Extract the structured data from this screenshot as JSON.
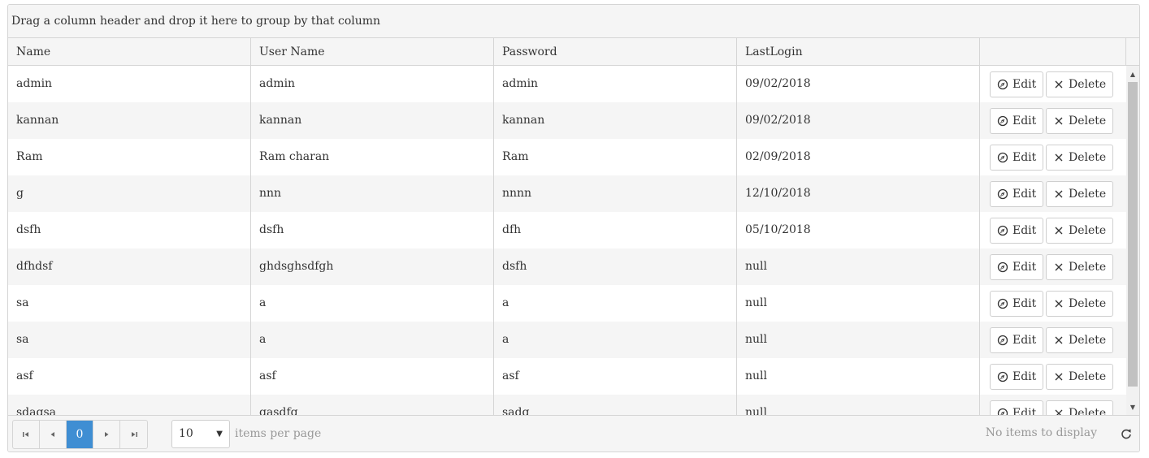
{
  "group_panel": {
    "hint": "Drag a column header and drop it here to group by that column"
  },
  "columns": [
    {
      "label": "Name"
    },
    {
      "label": "User Name"
    },
    {
      "label": "Password"
    },
    {
      "label": "LastLogin"
    },
    {
      "label": ""
    }
  ],
  "rows": [
    {
      "name": "admin",
      "user_name": "admin",
      "password": "admin",
      "last_login": "09/02/2018"
    },
    {
      "name": "kannan",
      "user_name": "kannan",
      "password": "kannan",
      "last_login": "09/02/2018"
    },
    {
      "name": "Ram",
      "user_name": "Ram charan",
      "password": "Ram",
      "last_login": "02/09/2018"
    },
    {
      "name": "g",
      "user_name": "nnn",
      "password": "nnnn",
      "last_login": "12/10/2018"
    },
    {
      "name": "dsfh",
      "user_name": "dsfh",
      "password": "dfh",
      "last_login": "05/10/2018"
    },
    {
      "name": "dfhdsf",
      "user_name": "ghdsghsdfgh",
      "password": "dsfh",
      "last_login": "null"
    },
    {
      "name": "sa",
      "user_name": "a",
      "password": "a",
      "last_login": "null"
    },
    {
      "name": "sa",
      "user_name": "a",
      "password": "a",
      "last_login": "null"
    },
    {
      "name": "asf",
      "user_name": "asf",
      "password": "asf",
      "last_login": "null"
    },
    {
      "name": "sdagsa",
      "user_name": "gasdfg",
      "password": "sadg",
      "last_login": "null"
    }
  ],
  "actions": {
    "edit_label": "Edit",
    "delete_label": "Delete"
  },
  "pager": {
    "current_page": "0",
    "page_size": "10",
    "items_per_page_label": "items per page",
    "status": "No items to display"
  },
  "icons": {
    "edit": "edit-compass-icon",
    "delete": "close-x-icon",
    "first": "seek-first-icon",
    "prev": "arrow-left-icon",
    "next": "arrow-right-icon",
    "last": "seek-last-icon",
    "refresh": "refresh-icon"
  },
  "colors": {
    "current_page": "#3f8ed3",
    "alt_row": "#f5f5f5",
    "border": "#d5d5d5"
  }
}
